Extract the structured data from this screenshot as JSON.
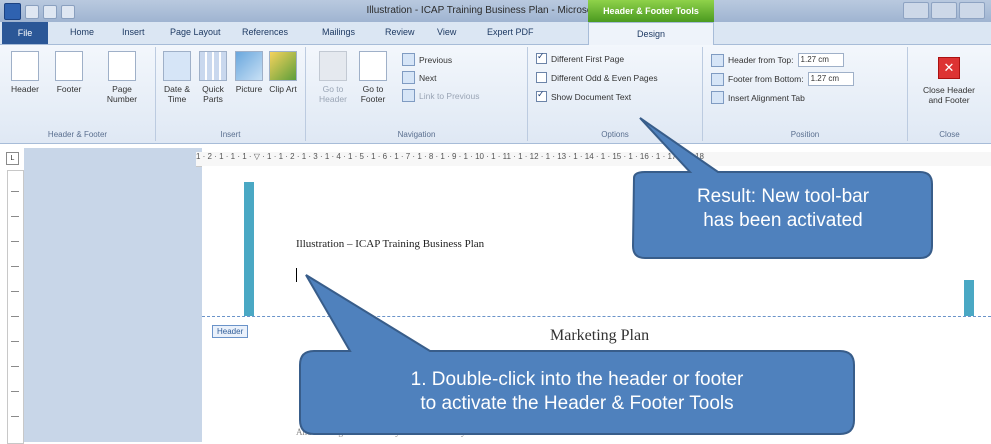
{
  "title_bar": {
    "window_title": "Illustration - ICAP Training Business Plan - Microsoft Word",
    "context_group": "Header & Footer Tools"
  },
  "tabs": {
    "file": "File",
    "items": [
      "Home",
      "Insert",
      "Page Layout",
      "References",
      "Mailings",
      "Review",
      "View",
      "Expert PDF"
    ],
    "design": "Design"
  },
  "ribbon": {
    "header_footer_group": {
      "label": "Header & Footer",
      "buttons": [
        "Header",
        "Footer",
        "Page Number"
      ]
    },
    "insert_group": {
      "label": "Insert",
      "buttons": [
        "Date & Time",
        "Quick Parts",
        "Picture",
        "Clip Art"
      ]
    },
    "navigation_group": {
      "label": "Navigation",
      "buttons": [
        "Go to Header",
        "Go to Footer"
      ],
      "small": [
        "Previous",
        "Next",
        "Link to Previous"
      ]
    },
    "options_group": {
      "label": "Options",
      "checkboxes": [
        {
          "label": "Different First Page",
          "checked": true
        },
        {
          "label": "Different Odd & Even Pages",
          "checked": false
        },
        {
          "label": "Show Document Text",
          "checked": true
        }
      ]
    },
    "position_group": {
      "label": "Position",
      "header_from_top_label": "Header from Top:",
      "header_from_top_value": "1.27 cm",
      "footer_from_bottom_label": "Footer from Bottom:",
      "footer_from_bottom_value": "1.27 cm",
      "insert_alignment_tab": "Insert Alignment Tab"
    },
    "close_group": {
      "label": "Close",
      "button": "Close Header and Footer"
    }
  },
  "ruler_text": "1 · 2 · 1 · 1 · 1 · ▽ · 1 · 1 · 2 · 1 · 3 · 1 · 4 · 1 · 5 · 1 · 6 · 1 · 7 · 1 · 8 · 1 · 9 · 1 · 10 · 1 · 11 · 1 · 12 · 1 · 13 · 1 · 14 · 1 · 15 · 1 · 16 · 1 · 17 · 1 · 18",
  "ruler_corner": "L",
  "document": {
    "header_text": "Illustration – ICAP Training Business Plan",
    "header_tag": "Header",
    "section_heading": "Marketing Plan",
    "body_snippet": "And this target that currently contains a variety of the..."
  },
  "callouts": {
    "result_line1": "Result: New tool-bar",
    "result_line2": "has been activated",
    "instruction_line1": "1. Double-click into the header or footer",
    "instruction_line2": "to activate the Header & Footer Tools",
    "fill_color": "#4f81bd",
    "stroke_color": "#385d8a"
  }
}
